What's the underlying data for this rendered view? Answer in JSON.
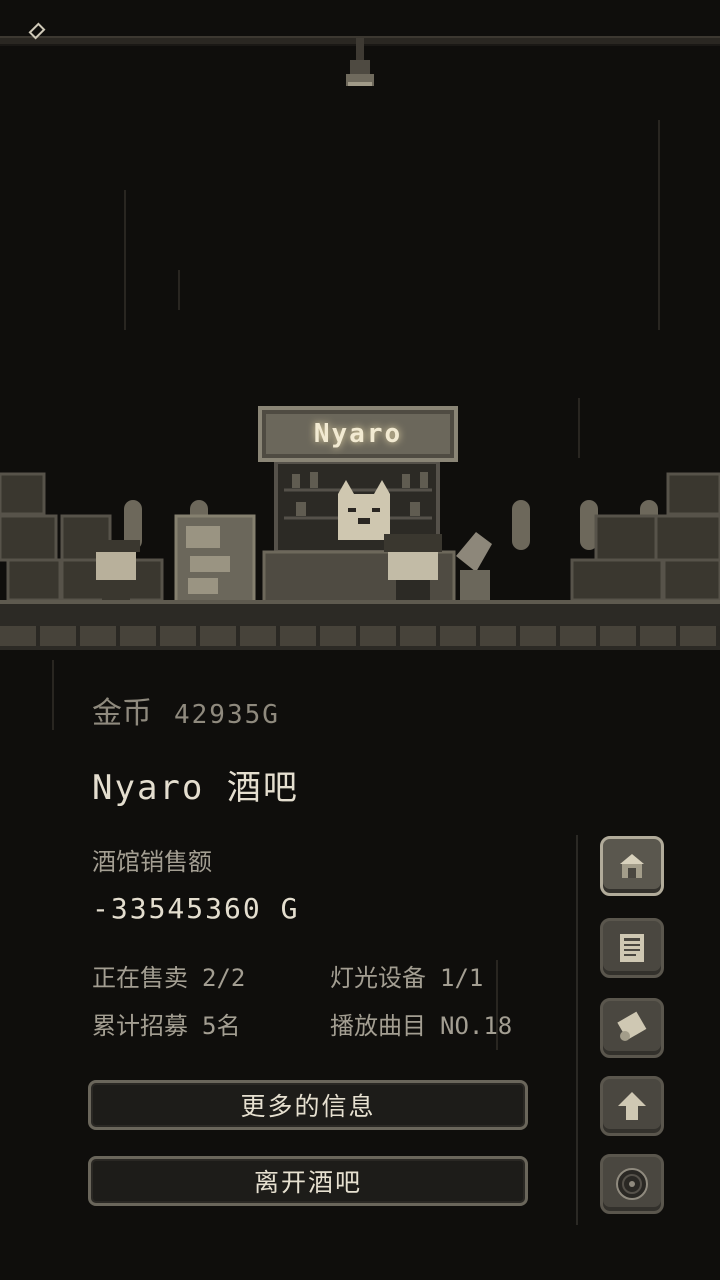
{
  "scene": {
    "shop_sign": "Nyaro"
  },
  "info": {
    "gold_label": "金币",
    "gold_value": "42935G",
    "bar_name": "Nyaro 酒吧",
    "sales_label": "酒馆销售额",
    "sales_value": "-33545360 G",
    "stats": [
      {
        "label": "正在售卖",
        "value": "2/2"
      },
      {
        "label": "灯光设备",
        "value": "1/1"
      },
      {
        "label": "累计招募",
        "value": "5名"
      },
      {
        "label": "播放曲目",
        "value": "NO.18"
      }
    ]
  },
  "buttons": {
    "more_info": "更多的信息",
    "leave_bar": "离开酒吧"
  },
  "side_menu": [
    {
      "icon": "bar-stall-icon",
      "active": true
    },
    {
      "icon": "newspaper-icon",
      "active": false
    },
    {
      "icon": "scroll-icon",
      "active": false
    },
    {
      "icon": "arrow-up-icon",
      "active": false
    },
    {
      "icon": "vinyl-record-icon",
      "active": false
    }
  ],
  "colors": {
    "background": "#0f0e0c",
    "text_primary": "#e4decf",
    "text_dim": "#8f8a7e",
    "accent_sign": "#f2ead2"
  }
}
